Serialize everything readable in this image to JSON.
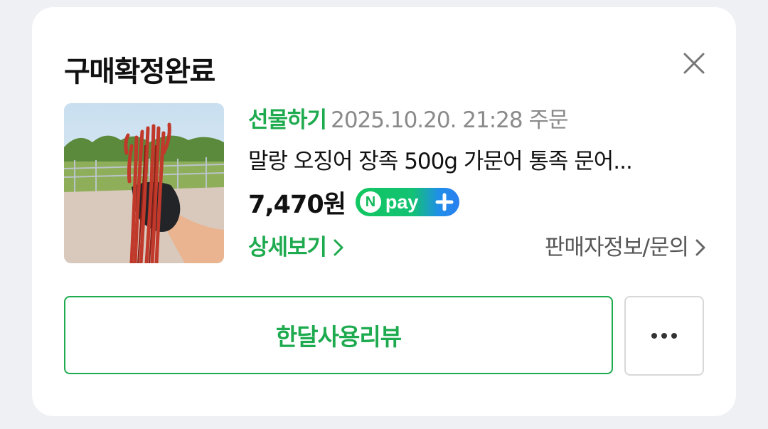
{
  "card": {
    "title": "구매확정완료",
    "close_icon": "close-icon"
  },
  "order": {
    "gift_label": "선물하기",
    "date": "2025.10.20. 21:28 주문",
    "product_name": "말랑 오징어 장족 500g 가문어 통족 문어...",
    "product_image_icon": "product-photo-dried-squid",
    "price": "7,470원",
    "npay_badge": {
      "n_letter": "N",
      "text": "pay",
      "icon": "plus-icon",
      "colors": [
        "#12c660",
        "#2b7ff0"
      ]
    }
  },
  "links": {
    "detail": "상세보기",
    "seller": "판매자정보/문의",
    "chevron_icon": "chevron-right-icon"
  },
  "actions": {
    "review_button": "한달사용리뷰",
    "more_icon": "more-dots-icon"
  },
  "colors": {
    "accent": "#1eaa4e",
    "background": "#eef0f3",
    "card": "#ffffff",
    "muted_text": "#8a8a8a"
  }
}
